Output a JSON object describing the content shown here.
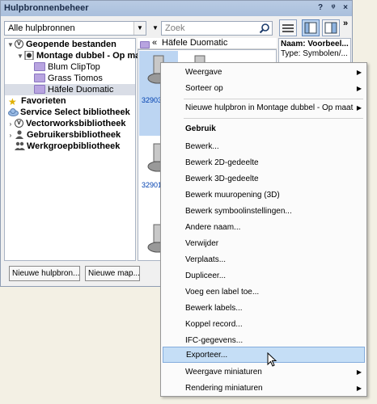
{
  "window": {
    "title": "Hulpbronnenbeheer",
    "buttons": {
      "help": "?",
      "pin": "ᵠ",
      "close": "×"
    },
    "overflow": "»"
  },
  "toolbar": {
    "filter_value": "Alle hulpbronnen",
    "search_placeholder": "Zoek"
  },
  "tree": {
    "items": [
      {
        "label": "Geopende bestanden"
      },
      {
        "label": "Montage dubbel - Op maat"
      },
      {
        "label": "Blum ClipTop"
      },
      {
        "label": "Grass Tiomos"
      },
      {
        "label": "Häfele Duomatic"
      },
      {
        "label": "Favorieten"
      },
      {
        "label": "Service Select bibliotheek"
      },
      {
        "label": "Vectorworksbibliotheek"
      },
      {
        "label": "Gebruikersbibliotheek"
      },
      {
        "label": "Werkgroepbibliotheek"
      }
    ]
  },
  "list": {
    "path": "Häfele Duomatic",
    "back": "«",
    "thumbs": [
      {
        "label": "32903"
      },
      {
        "label": ""
      },
      {
        "label": ""
      },
      {
        "label": "32901"
      },
      {
        "label": ""
      },
      {
        "label": ""
      }
    ]
  },
  "info": {
    "name": "Naam: Voorbeel...",
    "type": "Type: Symbolen/..."
  },
  "buttons": {
    "new_resource": "Nieuwe hulpbron...",
    "new_folder": "Nieuwe map..."
  },
  "menu": {
    "items": [
      {
        "label": "Weergave",
        "submenu": true
      },
      {
        "label": "Sorteer op",
        "submenu": true
      },
      {
        "label": "Nieuwe hulpbron in Montage dubbel - Op maat",
        "submenu": true
      },
      {
        "label": "Gebruik",
        "header": true
      },
      {
        "label": "Bewerk..."
      },
      {
        "label": "Bewerk 2D-gedeelte"
      },
      {
        "label": "Bewerk 3D-gedeelte"
      },
      {
        "label": "Bewerk muuropening (3D)"
      },
      {
        "label": "Bewerk symboolinstellingen..."
      },
      {
        "label": "Andere naam..."
      },
      {
        "label": "Verwijder"
      },
      {
        "label": "Verplaats..."
      },
      {
        "label": "Dupliceer..."
      },
      {
        "label": "Voeg een label toe..."
      },
      {
        "label": "Bewerk labels..."
      },
      {
        "label": "Koppel record..."
      },
      {
        "label": "IFC-gegevens..."
      },
      {
        "label": "Exporteer...",
        "highlighted": true
      },
      {
        "label": "Weergave miniaturen",
        "submenu": true
      },
      {
        "label": "Rendering miniaturen",
        "submenu": true
      }
    ]
  },
  "colors": {
    "titlebar": "#b9cbe3",
    "menu_highlight": "#c5def6",
    "thumb_selected": "#bcd5f2",
    "folder": "#b8a4e0"
  }
}
